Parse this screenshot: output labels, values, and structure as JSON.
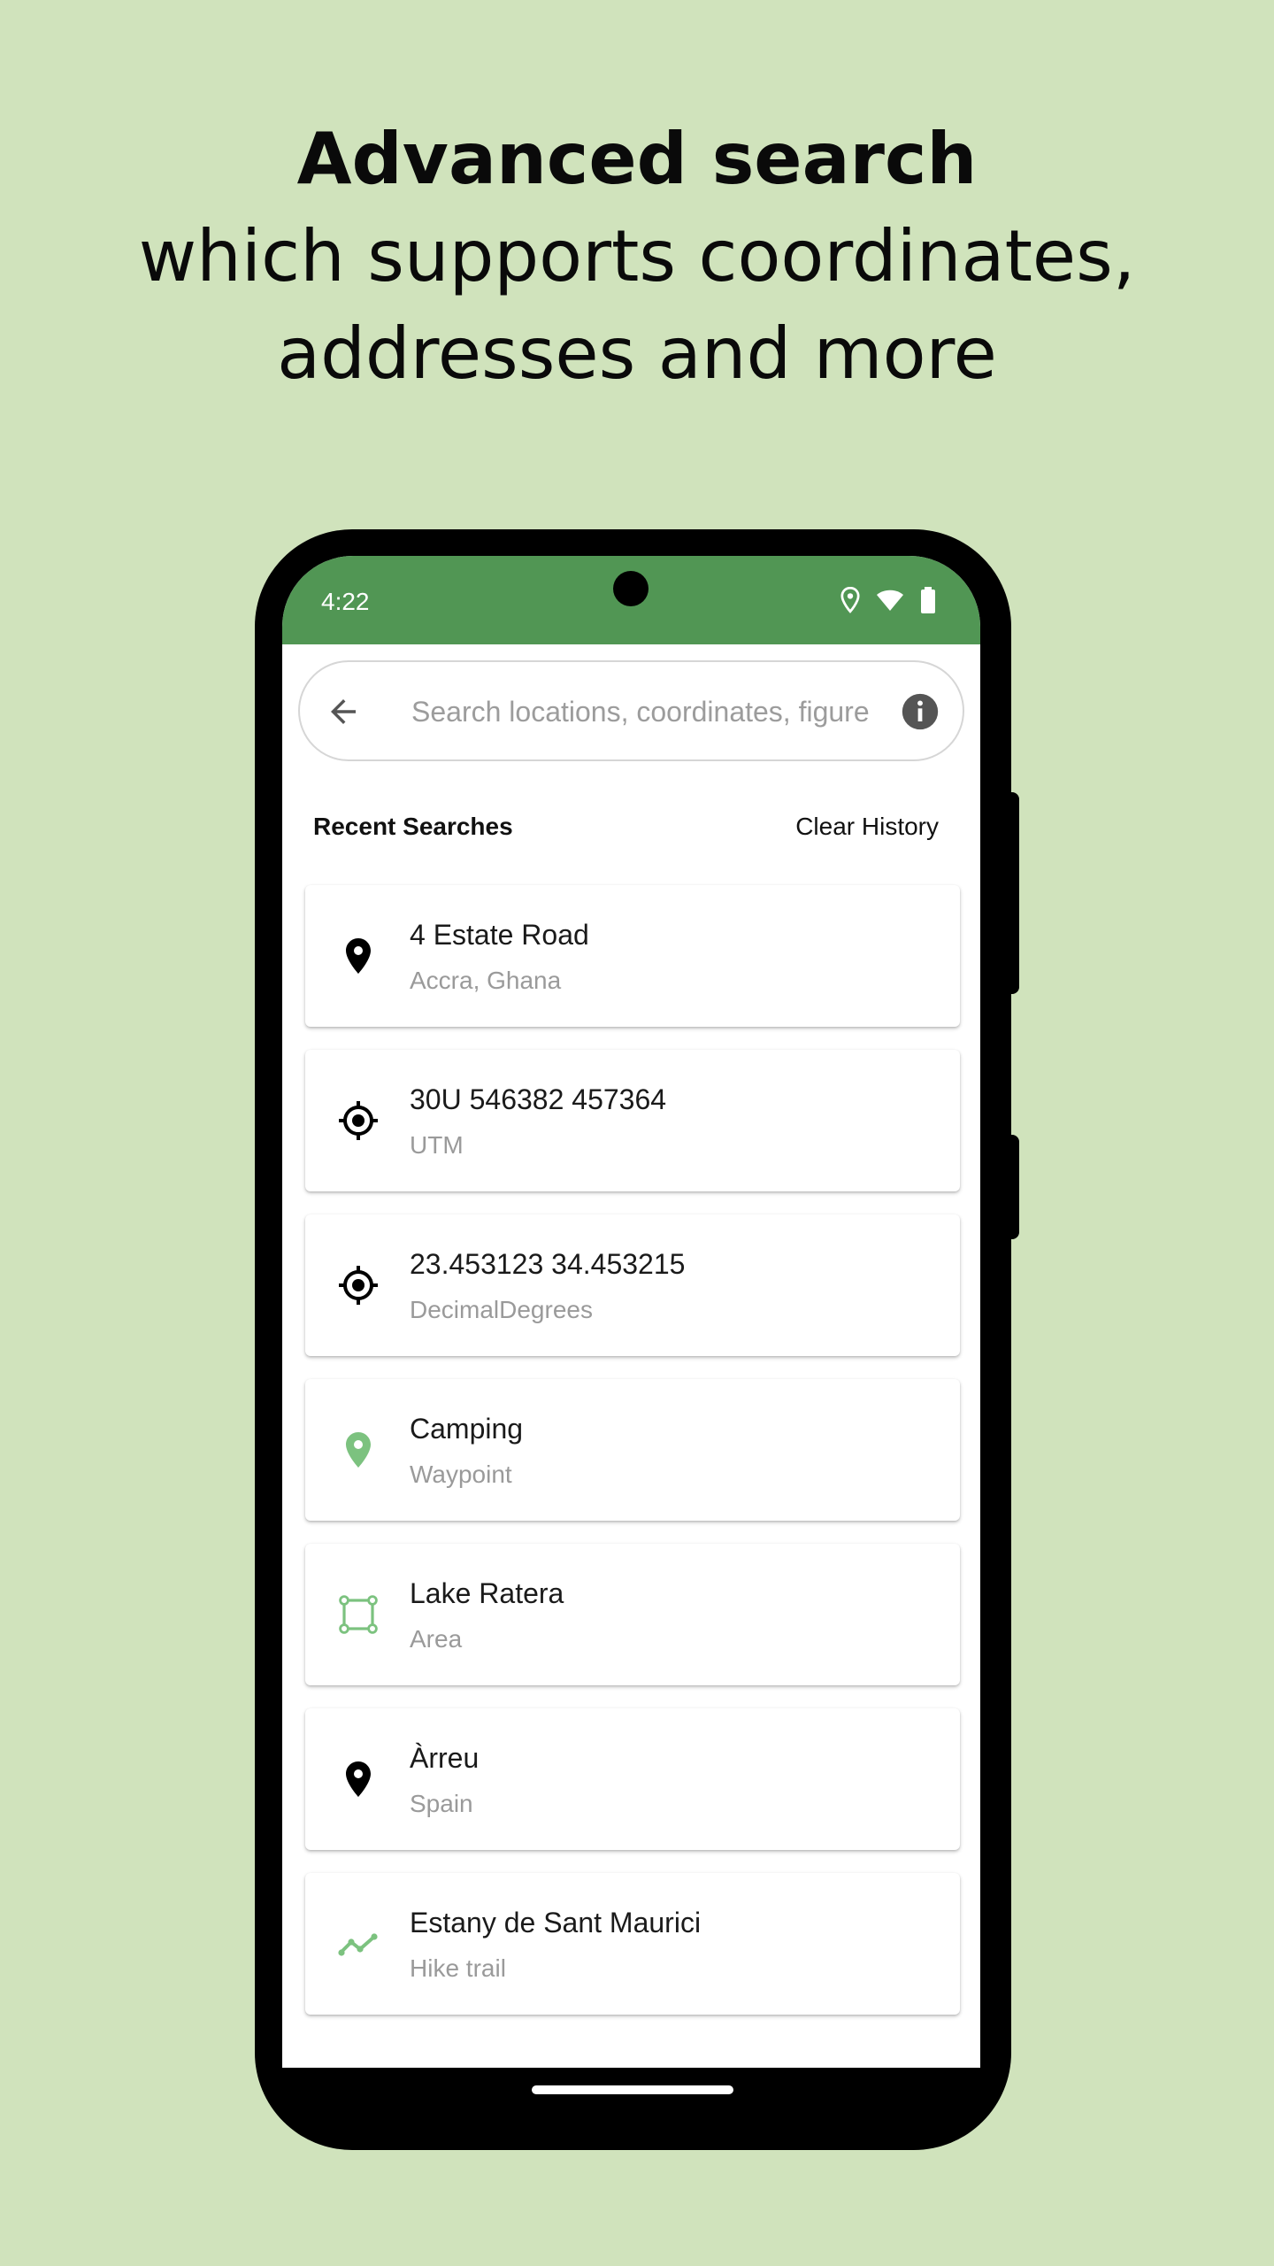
{
  "headline": {
    "line1": "Advanced search",
    "line2": "which supports coordinates,",
    "line3": "addresses and more"
  },
  "status_bar": {
    "time": "4:22",
    "icons": [
      "location-icon",
      "wifi-icon",
      "battery-icon"
    ],
    "color": "#519654"
  },
  "search": {
    "placeholder": "Search locations, coordinates, figure",
    "back_icon": "arrow-back-icon",
    "info_icon": "info-icon"
  },
  "recent": {
    "title": "Recent Searches",
    "clear_label": "Clear History",
    "items": [
      {
        "title": "4 Estate Road",
        "subtitle": "Accra, Ghana",
        "icon": "place-pin-icon"
      },
      {
        "title": "30U 546382 457364",
        "subtitle": "UTM",
        "icon": "crosshair-icon"
      },
      {
        "title": "23.453123 34.453215",
        "subtitle": "DecimalDegrees",
        "icon": "crosshair-icon"
      },
      {
        "title": "Camping",
        "subtitle": "Waypoint",
        "icon": "waypoint-pin-icon"
      },
      {
        "title": "Lake Ratera",
        "subtitle": "Area",
        "icon": "area-polygon-icon"
      },
      {
        "title": "Àrreu",
        "subtitle": "Spain",
        "icon": "place-pin-icon"
      },
      {
        "title": "Estany de Sant Maurici",
        "subtitle": "Hike trail",
        "icon": "trail-icon"
      }
    ]
  },
  "colors": {
    "background": "#d0e3bc",
    "accent_green": "#7cc27f",
    "status_green": "#519654"
  }
}
